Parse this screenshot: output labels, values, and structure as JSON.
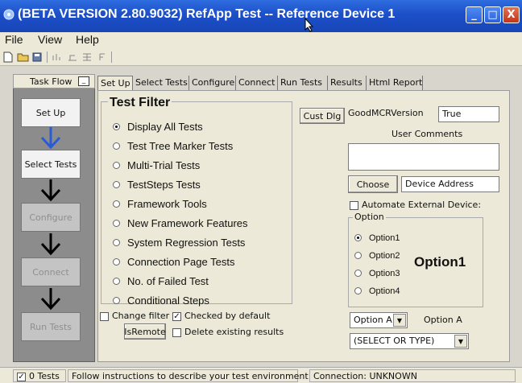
{
  "window": {
    "title": "(BETA VERSION 2.80.9032) RefApp Test -- Reference Device 1",
    "minimize": "_",
    "maximize": "□",
    "close": "X"
  },
  "menu": [
    "File",
    "View",
    "Help"
  ],
  "taskflow": {
    "header": "Task Flow",
    "steps": [
      {
        "label": "Set Up",
        "enabled": true
      },
      {
        "label": "Select Tests",
        "enabled": true
      },
      {
        "label": "Configure",
        "enabled": false
      },
      {
        "label": "Connect",
        "enabled": false
      },
      {
        "label": "Run Tests",
        "enabled": false
      }
    ]
  },
  "tabs": [
    "Set Up",
    "Select Tests",
    "Configure",
    "Connect",
    "Run Tests",
    "Results",
    "Html Report"
  ],
  "test_filter": {
    "heading": "Test Filter",
    "options": [
      "Display All Tests",
      "Test Tree Marker Tests",
      "Multi-Trial Tests",
      "TestSteps Tests",
      "Framework Tools",
      "New Framework Features",
      "System Regression Tests",
      "Connection Page Tests",
      "No. of Failed Test",
      "Conditional Steps"
    ],
    "selected": 0
  },
  "change_filter": {
    "label": "Change filter",
    "checked": false
  },
  "checked_by_default": {
    "label": "Checked by default",
    "checked": true
  },
  "is_remote_button": "IsRemote",
  "delete_existing": {
    "label": "Delete existing results",
    "checked": false
  },
  "cust_dlg_button": "Cust Dlg",
  "good_mcr": {
    "label": "GoodMCRVersion",
    "value": "True"
  },
  "user_comments": {
    "label": "User Comments",
    "value": ""
  },
  "choose_button": "Choose",
  "device_address": "Device Address",
  "automate_external": {
    "label": "Automate External Device:",
    "checked": false
  },
  "option_group": {
    "label": "Option",
    "options": [
      "Option1",
      "Option2",
      "Option3",
      "Option4"
    ],
    "selected": 0,
    "display": "Option1"
  },
  "option_combo": {
    "value": "Option A",
    "label": "Option A"
  },
  "select_combo": {
    "value": "(SELECT OR TYPE)"
  },
  "status": {
    "tests": "0 Tests",
    "message": "Follow instructions to describe your test environment",
    "connection": "Connection: UNKNOWN"
  },
  "colors": {
    "title_bar": "#1c4fc8",
    "task_flow_bg": "#8c8c8c",
    "arrow_blue": "#2a5bd7"
  }
}
